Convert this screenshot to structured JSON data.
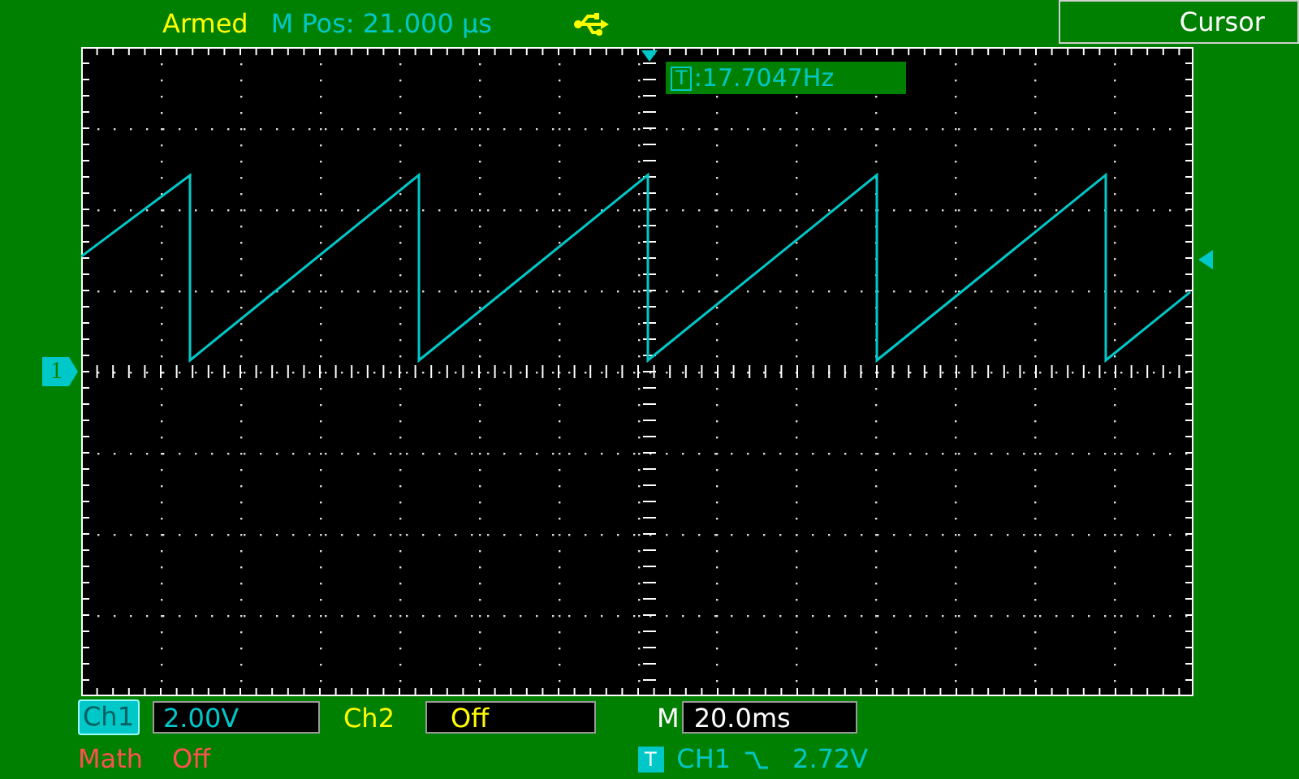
{
  "status": {
    "state": "Armed",
    "m_pos": "M Pos: 21.000 μs"
  },
  "menu_button": "Cursor",
  "frequency": {
    "badge": "T",
    "value": ":17.7047Hz"
  },
  "channel_marker": "1",
  "ch1": {
    "label": "Ch1",
    "scale": "2.00V"
  },
  "ch2": {
    "label": "Ch2",
    "scale": "Off"
  },
  "timebase": {
    "label": "M",
    "value": "20.0ms"
  },
  "math": {
    "label": "Math",
    "value": "Off"
  },
  "trigger": {
    "badge": "T",
    "source": "CH1",
    "level": "2.72V"
  }
}
